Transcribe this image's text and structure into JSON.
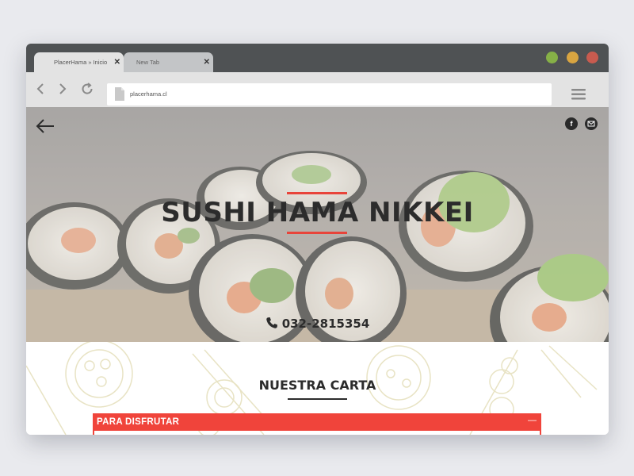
{
  "browser": {
    "tabs": [
      {
        "label": "PlacerHama » Inicio",
        "active": true
      },
      {
        "label": "New Tab",
        "active": false
      }
    ],
    "url": "placerhama.cl",
    "window_controls": {
      "green": "#86b047",
      "yellow": "#d9a541",
      "red": "#c85b4f"
    }
  },
  "hero": {
    "title": "SUSHI HAMA NIKKEI",
    "phone": "032-2815354",
    "accent": "#e8443a",
    "icons": [
      "back-arrow-icon",
      "facebook-icon",
      "mail-icon",
      "phone-icon"
    ]
  },
  "menu": {
    "heading": "NUESTRA CARTA",
    "category": "PARA DISFRUTAR",
    "category_toggle": "—",
    "category_color": "#f0443b"
  }
}
